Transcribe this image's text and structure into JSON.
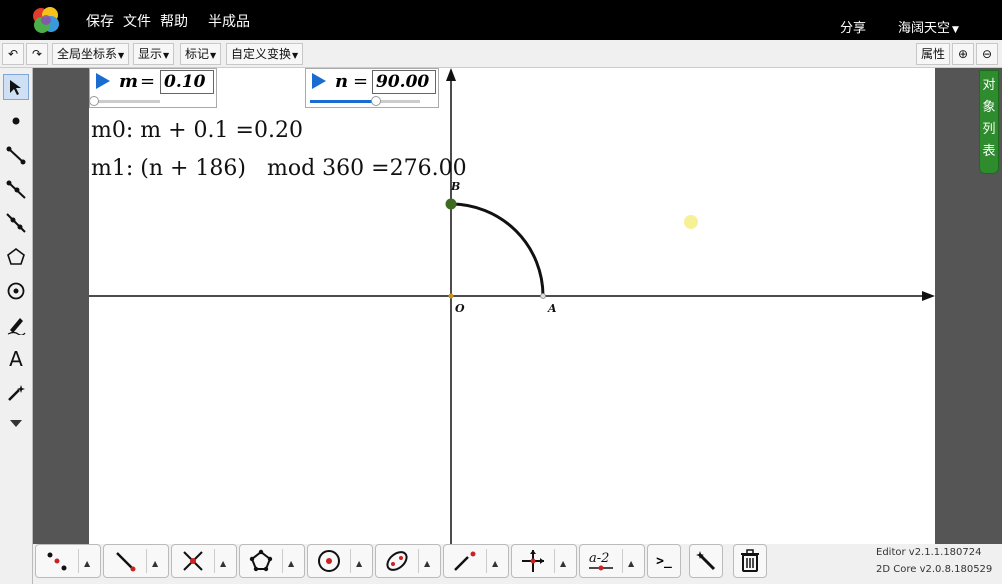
{
  "menu": {
    "save": "保存",
    "file": "文件",
    "help": "帮助",
    "product": "半成品"
  },
  "account": {
    "share": "分享",
    "user": "海阔天空"
  },
  "toolbar": {
    "undo": "↶",
    "redo": "↷",
    "coord": "全局坐标系",
    "display": "显示",
    "mark": "标记",
    "transform": "自定义变换",
    "props": "属性",
    "zoom_in": "⊕",
    "zoom_out": "⊖"
  },
  "left_tools": [
    {
      "name": "select-arrow-icon"
    },
    {
      "name": "point-icon"
    },
    {
      "name": "segment-icon"
    },
    {
      "name": "ray-icon"
    },
    {
      "name": "line-icon"
    },
    {
      "name": "polygon-icon"
    },
    {
      "name": "circle-icon"
    },
    {
      "name": "pen-icon"
    },
    {
      "name": "text-icon",
      "glyph": "A"
    },
    {
      "name": "magic-wand-icon"
    },
    {
      "name": "more-tools-chevron-icon"
    }
  ],
  "sliders": {
    "m": {
      "name": "m",
      "eq": "=",
      "value": "0.10",
      "fraction": 0.0
    },
    "n": {
      "name": "n",
      "eq": "=",
      "value": "90.00",
      "fraction": 0.6
    }
  },
  "measurements": {
    "m0": "m0: m + 0.1 =0.20",
    "m1": "m1: (n + 186)   mod 360 =276.00"
  },
  "points": {
    "O": "O",
    "A": "A",
    "B": "B"
  },
  "right_panel": {
    "tab": "对象列表"
  },
  "bottom_tools": [
    {
      "name": "points-tool-icon"
    },
    {
      "name": "segment-tool-icon"
    },
    {
      "name": "intersect-tool-icon"
    },
    {
      "name": "polygon-tool-icon"
    },
    {
      "name": "circle-tool-icon"
    },
    {
      "name": "ellipse-tool-icon"
    },
    {
      "name": "line-point-tool-icon"
    },
    {
      "name": "axes-tool-icon"
    },
    {
      "name": "measure-tool-icon",
      "glyph": "a-2"
    },
    {
      "name": "terminal-icon",
      "glyph": ">_"
    },
    {
      "name": "magic-wand-icon"
    },
    {
      "name": "trash-icon"
    }
  ],
  "version": {
    "editor": "Editor v2.1.1.180724",
    "core": "2D Core v2.0.8.180529"
  },
  "colors": {
    "accent": "#1b6cd0",
    "point_B": "#3d6b20",
    "panel_green": "#2e8b2e"
  }
}
